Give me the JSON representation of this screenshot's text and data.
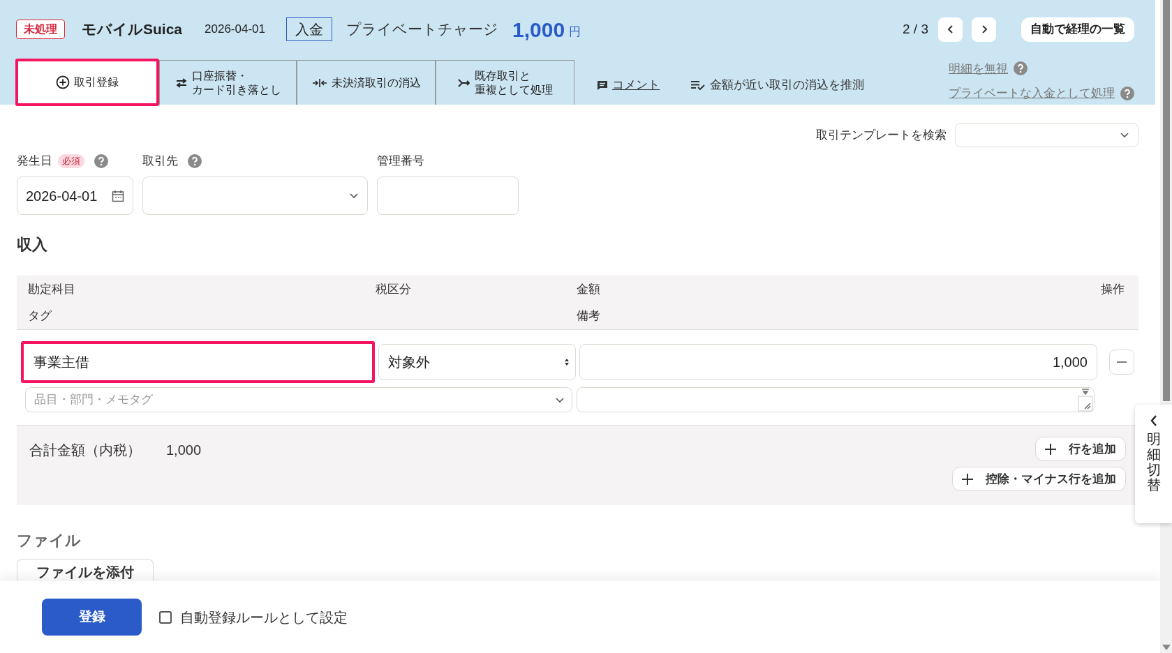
{
  "header": {
    "status_badge": "未処理",
    "account": "モバイルSuica",
    "date": "2026-04-01",
    "type_badge": "入金",
    "description": "プライベートチャージ",
    "amount": "1,000",
    "currency": "円",
    "pager": "2 / 3",
    "list_button": "自動で経理の一覧"
  },
  "tabs": [
    {
      "kind": "register",
      "lines": [
        "取引登録"
      ],
      "selected": true,
      "highlighted": true
    },
    {
      "kind": "transfer",
      "lines": [
        "口座振替・",
        "カード引き落とし"
      ],
      "selected": false,
      "highlighted": false
    },
    {
      "kind": "settle",
      "lines": [
        "未決済取引の消込"
      ],
      "selected": false,
      "highlighted": false
    },
    {
      "kind": "duplicate",
      "lines": [
        "既存取引と",
        "重複として処理"
      ],
      "selected": false,
      "highlighted": false
    }
  ],
  "actions": [
    {
      "kind": "comment",
      "label": "コメント"
    },
    {
      "kind": "guess",
      "label": "金額が近い取引の消込を推測"
    }
  ],
  "side_links": [
    "明細を無視",
    "プライベートな入金として処理"
  ],
  "template_search": {
    "label": "取引テンプレートを検索"
  },
  "fields": [
    {
      "kind": "date",
      "label": "発生日",
      "required_badge": "必須",
      "help": true,
      "value": "2026-04-01"
    },
    {
      "kind": "select",
      "label": "取引先",
      "help": true
    },
    {
      "kind": "text",
      "label": "管理番号",
      "help": false
    }
  ],
  "income": {
    "title": "収入",
    "columns": [
      "勘定科目",
      "税区分",
      "金額",
      "操作"
    ],
    "subcolumns": [
      "タグ",
      "備考"
    ],
    "rows": [
      {
        "account": "事業主借",
        "highlighted": true,
        "tax": "対象外",
        "amount": "1,000",
        "tag_placeholder": "品目・部門・メモタグ"
      }
    ],
    "total_label": "合計金額（内税）",
    "total": "1,000",
    "add_buttons": [
      "行を追加",
      "控除・マイナス行を追加"
    ]
  },
  "files": {
    "title": "ファイル",
    "attach_button": "ファイルを添付"
  },
  "footer": {
    "submit": "登録",
    "auto_rule": {
      "label": "自動登録ルールとして設定",
      "checked": false
    }
  },
  "side_tab": {
    "label": "明細切替"
  }
}
